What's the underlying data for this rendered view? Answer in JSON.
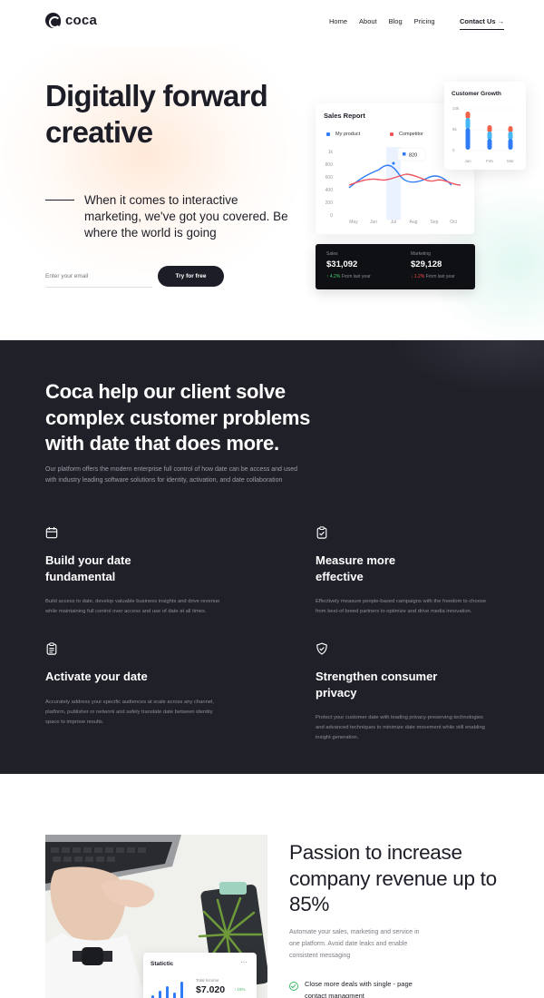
{
  "brand": {
    "name": "coca"
  },
  "nav": {
    "items": [
      "Home",
      "About",
      "Blog",
      "Pricing"
    ],
    "contact": "Contact Us →"
  },
  "hero": {
    "title": "Digitally forward creative",
    "subtitle": "When it comes to interactive marketing, we've got you covered. Be where the world is going",
    "email_placeholder": "Enter your email",
    "cta": "Try for free"
  },
  "sales_report": {
    "title": "Sales Report",
    "legend": [
      "My product",
      "Competitor"
    ],
    "colors": {
      "my_product": "#2f7cf6",
      "competitor": "#f0545f",
      "highlight": "#eaf2ff"
    },
    "y_ticks": [
      "1k",
      "800",
      "600",
      "400",
      "200",
      "0"
    ],
    "x_ticks": [
      "May",
      "Jun",
      "Jul",
      "Aug",
      "Sep",
      "Oct"
    ],
    "tooltip": "820"
  },
  "customer_growth": {
    "title": "Customer Growth",
    "y_ticks": [
      "10k",
      "5k",
      "0"
    ],
    "x_ticks": [
      "Jan",
      "Feb",
      "Mar"
    ],
    "colors": {
      "segment_a": "#2f7cf6",
      "segment_b": "#46b6f5",
      "segment_c": "#f0624a"
    }
  },
  "stats": [
    {
      "label": "Sales",
      "value": "$31,092",
      "change": "↑ 4.2%",
      "note": "From last year",
      "trend": "up"
    },
    {
      "label": "Marketing",
      "value": "$29,128",
      "change": "↓ 1.2%",
      "note": "From last year",
      "trend": "down"
    }
  ],
  "features_section": {
    "title": "Coca help our client solve complex customer problems with date that does more.",
    "description": "Our platform offers the modern enterprise full control of how date can be access and used with industry leading software solutions for identity, activation, and date collaboration",
    "features": [
      {
        "icon": "calendar-icon",
        "title": "Build your date fundamental",
        "desc": "Build access to date, develop valuable business insights and drive revenue while maintaining full control over access and use of date at all times."
      },
      {
        "icon": "clipboard-check-icon",
        "title": "Measure more effective",
        "desc": "Effectively measure people-based campaigns with the freedom to choose from best-of breed partners to optimize and drive media innovation."
      },
      {
        "icon": "checklist-icon",
        "title": "Activate your date",
        "desc": "Accurately address your specific audiences at scale across any channel, platform, publisher or network and safely translate date between identity space to improve results."
      },
      {
        "icon": "shield-check-icon",
        "title": "Strengthen consumer privacy",
        "desc": "Protect your customer date with leading privacy-preserving technologies and advanced techniques to minimize date movement while still enabling insight generation."
      }
    ]
  },
  "revenue_section": {
    "title": "Passion to increase company revenue up to 85%",
    "description": "Automate your sales, marketing and service in one platform. Avoid date leaks and enable consistent messaging",
    "checks": [
      "Close more deals with single - page contact managment"
    ],
    "widget": {
      "title": "Statictic",
      "menu": "···",
      "label": "Total Income",
      "value": "$7.020",
      "badge": "↑ 15%"
    }
  }
}
